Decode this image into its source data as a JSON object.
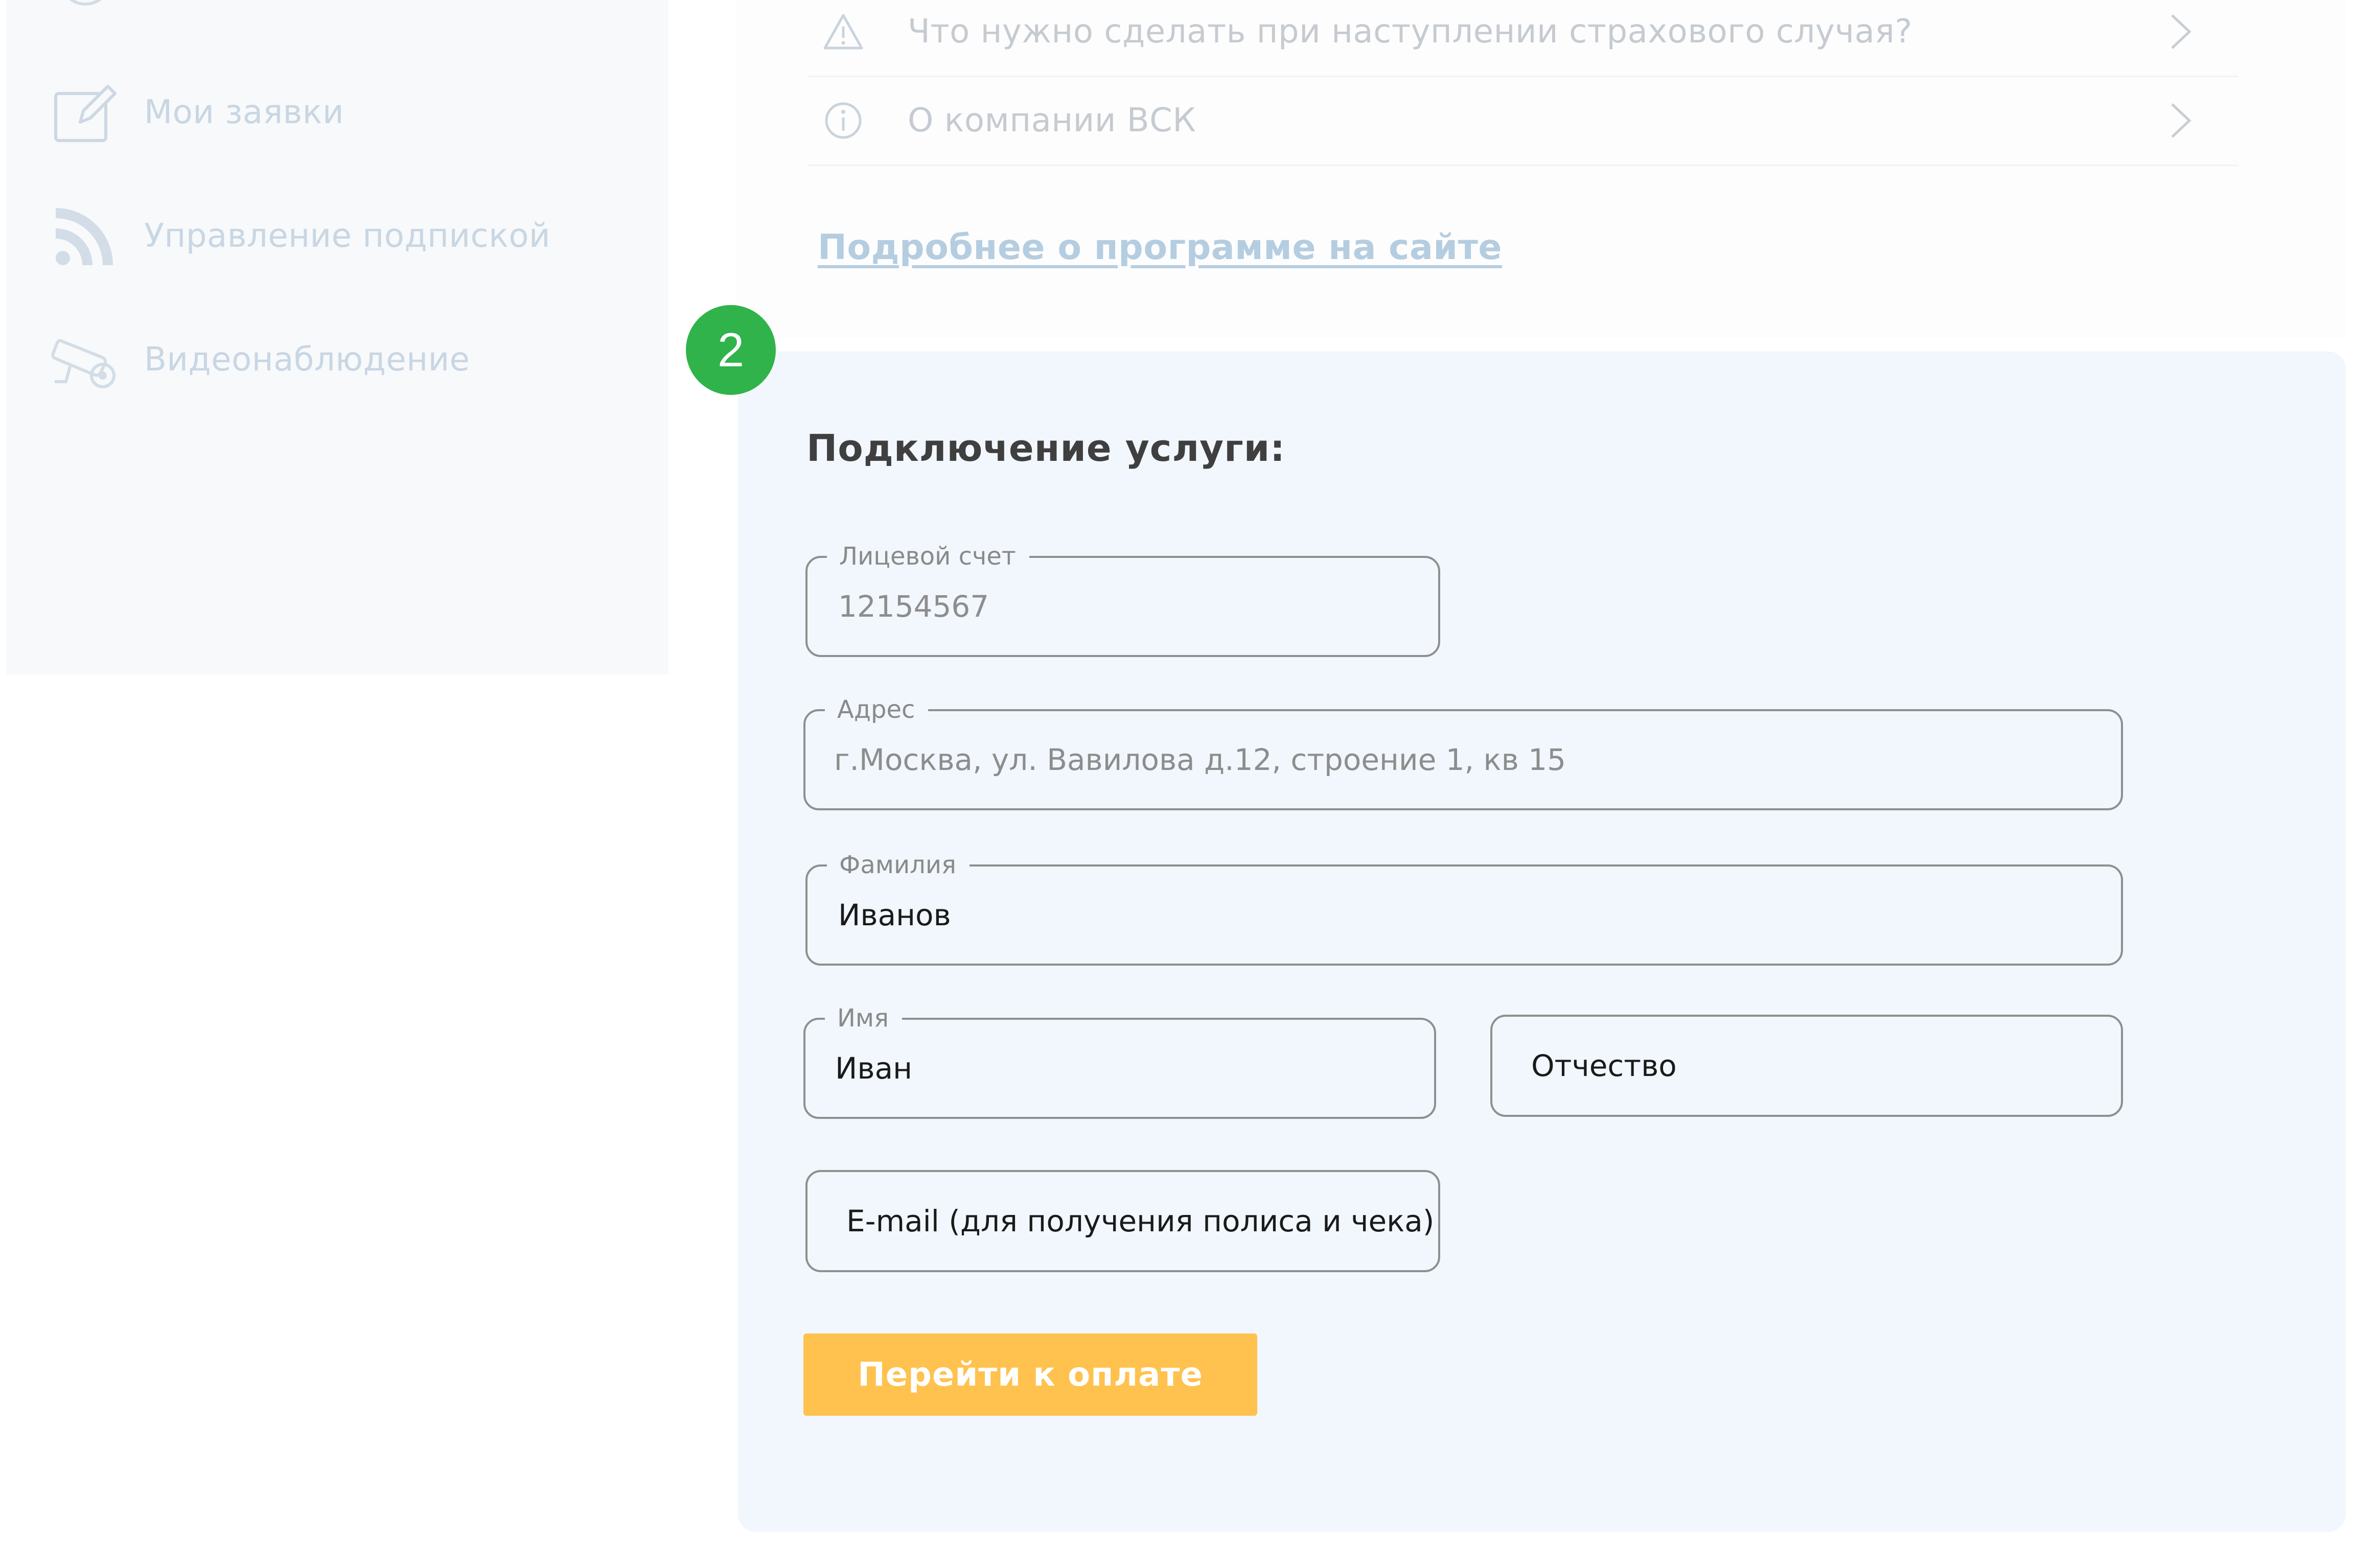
{
  "sidebar": {
    "items": [
      {
        "label": "Мои заявки",
        "icon": "edit-icon"
      },
      {
        "label": "Управление подпиской",
        "icon": "rss-icon"
      },
      {
        "label": "Видеонаблюдение",
        "icon": "camera-icon"
      }
    ]
  },
  "info": {
    "faq": [
      {
        "text": "Что нужно сделать при наступлении страхового случая?",
        "icon": "warning-icon"
      },
      {
        "text": "О компании ВСК",
        "icon": "info-icon"
      }
    ],
    "more_link": "Подробнее о программе на сайте"
  },
  "form": {
    "step": "2",
    "title": "Подключение услуги:",
    "fields": {
      "account": {
        "label": "Лицевой счет",
        "value": "12154567"
      },
      "address": {
        "label": "Адрес",
        "value": "г.Москва, ул. Вавилова д.12, строение 1, кв 15"
      },
      "surname": {
        "label": "Фамилия",
        "value": "Иванов"
      },
      "name": {
        "label": "Имя",
        "value": "Иван"
      },
      "patronymic": {
        "placeholder": "Отчество"
      },
      "email": {
        "placeholder": "E-mail (для получения полиса и чека)"
      }
    },
    "submit_label": "Перейти к оплате"
  },
  "colors": {
    "accent_button": "#ffc24f",
    "step_badge": "#2fb34a",
    "form_background": "#f1f7fd",
    "field_border": "#8f8f8f"
  }
}
